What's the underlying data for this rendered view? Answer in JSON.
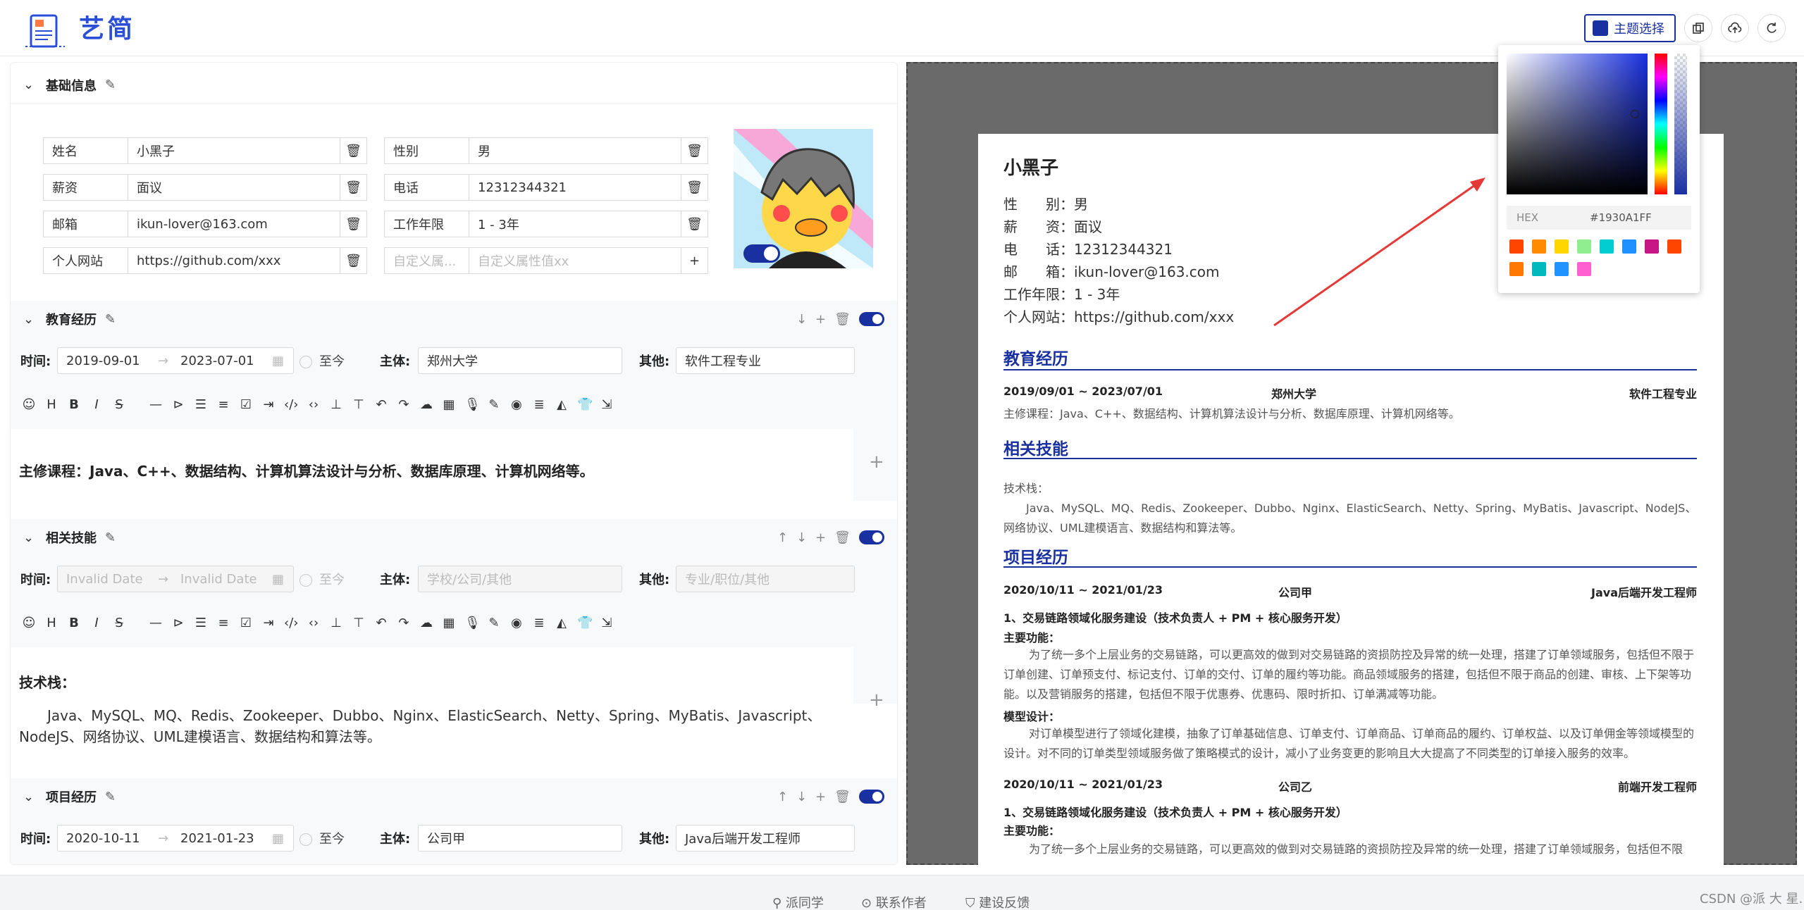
{
  "app": {
    "logo_text": "艺简"
  },
  "header": {
    "theme_label": "主题选择",
    "accent": "#1930A1"
  },
  "basic": {
    "title": "基础信息",
    "fields": [
      {
        "label": "姓名",
        "value": "小黑子"
      },
      {
        "label": "性别",
        "value": "男"
      },
      {
        "label": "薪资",
        "value": "面议"
      },
      {
        "label": "电话",
        "value": "12312344321"
      },
      {
        "label": "邮箱",
        "value": "ikun-lover@163.com"
      },
      {
        "label": "工作年限",
        "value": "1 - 3年"
      },
      {
        "label": "个人网站",
        "value": "https://github.com/xxx"
      }
    ],
    "custom_label_placeholder": "自定义属...",
    "custom_value_placeholder": "自定义属性值xx"
  },
  "labels": {
    "time": "时间:",
    "subject": "主体:",
    "other": "其他:",
    "until_now": "至今"
  },
  "education": {
    "title": "教育经历",
    "start": "2019-09-01",
    "end": "2023-07-01",
    "subject": "郑州大学",
    "other": "软件工程专业",
    "content": "主修课程：Java、C++、数据结构、计算机算法设计与分析、数据库原理、计算机网络等。"
  },
  "skills": {
    "title": "相关技能",
    "start_placeholder": "Invalid Date",
    "end_placeholder": "Invalid Date",
    "subject_placeholder": "学校/公司/其他",
    "other_placeholder": "专业/职位/其他",
    "content_title": "技术栈：",
    "content": "Java、MySQL、MQ、Redis、Zookeeper、Dubbo、Nginx、ElasticSearch、Netty、Spring、MyBatis、Javascript、NodeJS、网络协议、UML建模语言、数据结构和算法等。"
  },
  "projects": {
    "title": "项目经历",
    "start": "2020-10-11",
    "end": "2021-01-23",
    "subject": "公司甲",
    "other": "Java后端开发工程师"
  },
  "preview": {
    "name": "小黑子",
    "info": [
      {
        "label": "性　　别：",
        "value": "男"
      },
      {
        "label": "薪　　资：",
        "value": "面议"
      },
      {
        "label": "电　　话：",
        "value": "12312344321"
      },
      {
        "label": "邮　　箱：",
        "value": "ikun-lover@163.com"
      },
      {
        "label": "工作年限：",
        "value": "1 - 3年"
      },
      {
        "label": "个人网站：",
        "value": "https://github.com/xxx"
      }
    ],
    "edu_title": "教育经历",
    "edu_date": "2019/09/01 ~ 2023/07/01",
    "edu_subject": "郑州大学",
    "edu_other": "软件工程专业",
    "edu_text": "主修课程：Java、C++、数据结构、计算机算法设计与分析、数据库原理、计算机网络等。",
    "skills_title": "相关技能",
    "skills_head": "技术栈：",
    "skills_text": "Java、MySQL、MQ、Redis、Zookeeper、Dubbo、Nginx、ElasticSearch、Netty、Spring、MyBatis、Javascript、NodeJS、网络协议、UML建模语言、数据结构和算法等。",
    "proj_title": "项目经历",
    "proj1_date": "2020/10/11 ~ 2021/01/23",
    "proj1_subject": "公司甲",
    "proj1_role": "Java后端开发工程师",
    "proj1_line1": "1、交易链路领域化服务建设（技术负责人 + PM + 核心服务开发）",
    "proj1_func_head": "主要功能：",
    "proj1_func": "为了统一多个上层业务的交易链路，可以更高效的做到对交易链路的资损防控及异常的统一处理，搭建了订单领域服务，包括但不限于订单创建、订单预支付、标记支付、订单的交付、订单的履约等功能。商品领域服务的搭建，包括但不限于商品的创建、审核、上下架等功能。以及营销服务的搭建，包括但不限于优惠券、优惠码、限时折扣、订单满减等功能。",
    "proj1_model_head": "模型设计：",
    "proj1_model": "对订单模型进行了领域化建模，抽象了订单基础信息、订单支付、订单商品、订单商品的履约、订单权益、以及订单佣金等领域模型的设计。对不同的订单类型领域服务做了策略模式的设计，减小了业务变更的影响且大大提高了不同类型的订单接入服务的效率。",
    "proj2_date": "2020/10/11 ~ 2021/01/23",
    "proj2_subject": "公司乙",
    "proj2_role": "前端开发工程师",
    "proj2_line1": "1、交易链路领域化服务建设（技术负责人 + PM + 核心服务开发）",
    "proj2_func_head": "主要功能：",
    "proj2_func": "为了统一多个上层业务的交易链路，可以更高效的做到对交易链路的资损防控及异常的统一处理，搭建了订单领域服务，包括但不限"
  },
  "picker": {
    "hex_label": "HEX",
    "hex_value": "#1930A1FF",
    "swatches": [
      "#ff4500",
      "#ff8c00",
      "#ffd700",
      "#90ee90",
      "#00ced1",
      "#1e90ff",
      "#c71585",
      "#ff4500",
      "#ff7800",
      "#00babd",
      "#1f93ff",
      "#ff5fd0"
    ]
  },
  "footer": {
    "links": [
      "派同学",
      "联系作者",
      "建设反馈"
    ],
    "watermark": "CSDN @派 大 星."
  }
}
